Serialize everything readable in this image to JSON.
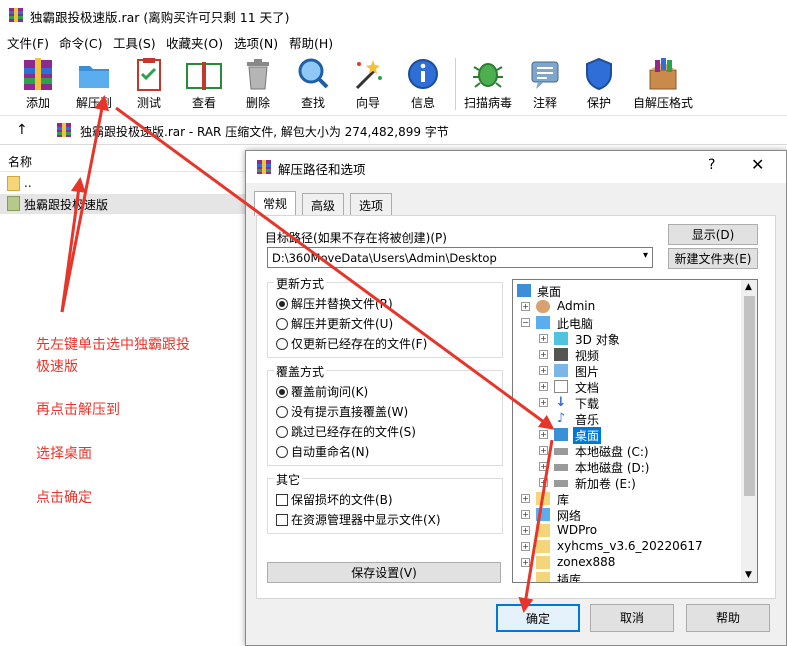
{
  "window": {
    "title": "独霸跟投极速版.rar (离购买许可只剩 11 天了)"
  },
  "menu": [
    "文件(F)",
    "命令(C)",
    "工具(S)",
    "收藏夹(O)",
    "选项(N)",
    "帮助(H)"
  ],
  "toolbar": [
    "添加",
    "解压到",
    "测试",
    "查看",
    "删除",
    "查找",
    "向导",
    "信息",
    "扫描病毒",
    "注释",
    "保护",
    "自解压格式"
  ],
  "address": {
    "text": "独霸跟投极速版.rar - RAR 压缩文件, 解包大小为 274,482,899 字节"
  },
  "list": {
    "header": "名称",
    "rows": [
      "..",
      "独霸跟投极速版"
    ]
  },
  "instructions": [
    "先左键单击选中独霸跟投",
    "极速版",
    "再点击解压到",
    "选择桌面",
    "点击确定"
  ],
  "dialog": {
    "title": "解压路径和选项",
    "help": "?",
    "close": "✕",
    "tabs": [
      "常规",
      "高级",
      "选项"
    ],
    "path_label": "目标路径(如果不存在将被创建)(P)",
    "path_value": "D:\\360MoveData\\Users\\Admin\\Desktop",
    "show_button": "显示(D)",
    "newfolder_button": "新建文件夹(E)",
    "update_mode": {
      "title": "更新方式",
      "options": [
        "解压并替换文件(R)",
        "解压并更新文件(U)",
        "仅更新已经存在的文件(F)"
      ],
      "selected": 0
    },
    "overwrite_mode": {
      "title": "覆盖方式",
      "options": [
        "覆盖前询问(K)",
        "没有提示直接覆盖(W)",
        "跳过已经存在的文件(S)",
        "自动重命名(N)"
      ],
      "selected": 0
    },
    "misc": {
      "title": "其它",
      "options": [
        "保留损坏的文件(B)",
        "在资源管理器中显示文件(X)"
      ]
    },
    "save_button": "保存设置(V)",
    "tree": [
      "桌面",
      "Admin",
      "此电脑",
      "3D 对象",
      "视频",
      "图片",
      "文档",
      "下载",
      "音乐",
      "桌面",
      "本地磁盘 (C:)",
      "本地磁盘 (D:)",
      "新加卷 (E:)",
      "库",
      "网络",
      "WDPro",
      "xyhcms_v3.6_20220617",
      "zonex888",
      "插库"
    ],
    "tree_selected": 9,
    "ok_button": "确定",
    "cancel_button": "取消",
    "help_button": "帮助"
  },
  "colors": {
    "annotation": "#e8352a",
    "selection": "#0078d7"
  }
}
